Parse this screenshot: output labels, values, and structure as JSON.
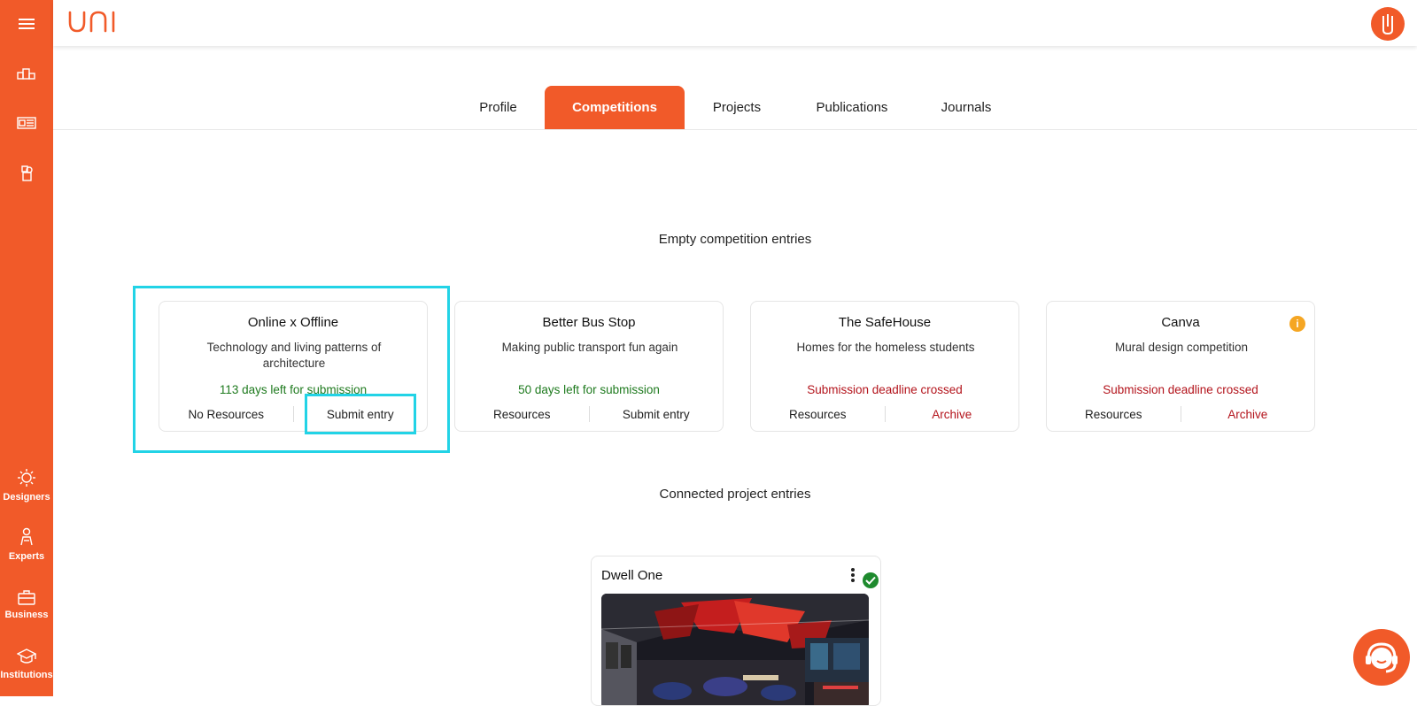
{
  "app": {
    "logo_text": "uni"
  },
  "sidebar": {
    "items": [
      {
        "icon": "menu-icon"
      },
      {
        "icon": "podium-icon"
      },
      {
        "icon": "layout-list-icon"
      },
      {
        "icon": "shapes-icon"
      },
      {
        "icon": "designers-icon",
        "label": "Designers"
      },
      {
        "icon": "experts-icon",
        "label": "Experts"
      },
      {
        "icon": "briefcase-icon",
        "label": "Business"
      },
      {
        "icon": "graduation-cap-icon",
        "label": "Institutions"
      }
    ]
  },
  "tabs": [
    {
      "label": "Profile",
      "active": false
    },
    {
      "label": "Competitions",
      "active": true
    },
    {
      "label": "Projects",
      "active": false
    },
    {
      "label": "Publications",
      "active": false
    },
    {
      "label": "Journals",
      "active": false
    }
  ],
  "sections": {
    "empty_entries_title": "Empty competition entries",
    "connected_entries_title": "Connected project entries"
  },
  "competitions": [
    {
      "title": "Online x Offline",
      "description": "Technology and living patterns of architecture",
      "status": "113 days left for submission",
      "status_type": "open",
      "left_action": "No Resources",
      "right_action": "Submit entry"
    },
    {
      "title": "Better Bus Stop",
      "description": "Making public transport fun again",
      "status": "50 days left for submission",
      "status_type": "open",
      "left_action": "Resources",
      "right_action": "Submit entry"
    },
    {
      "title": "The SafeHouse",
      "description": "Homes for the homeless students",
      "status": "Submission deadline crossed",
      "status_type": "closed",
      "left_action": "Resources",
      "right_action": "Archive"
    },
    {
      "title": "Canva",
      "description": "Mural design competition",
      "status": "Submission deadline crossed",
      "status_type": "closed",
      "left_action": "Resources",
      "right_action": "Archive",
      "badge": "i"
    }
  ],
  "project": {
    "title": "Dwell One"
  },
  "colors": {
    "brand": "#f15a29",
    "open_status": "#1e7a1e",
    "closed_status": "#b3131b",
    "highlight": "#22d3e6",
    "info": "#f5a623",
    "verified": "#1e8a2e"
  }
}
